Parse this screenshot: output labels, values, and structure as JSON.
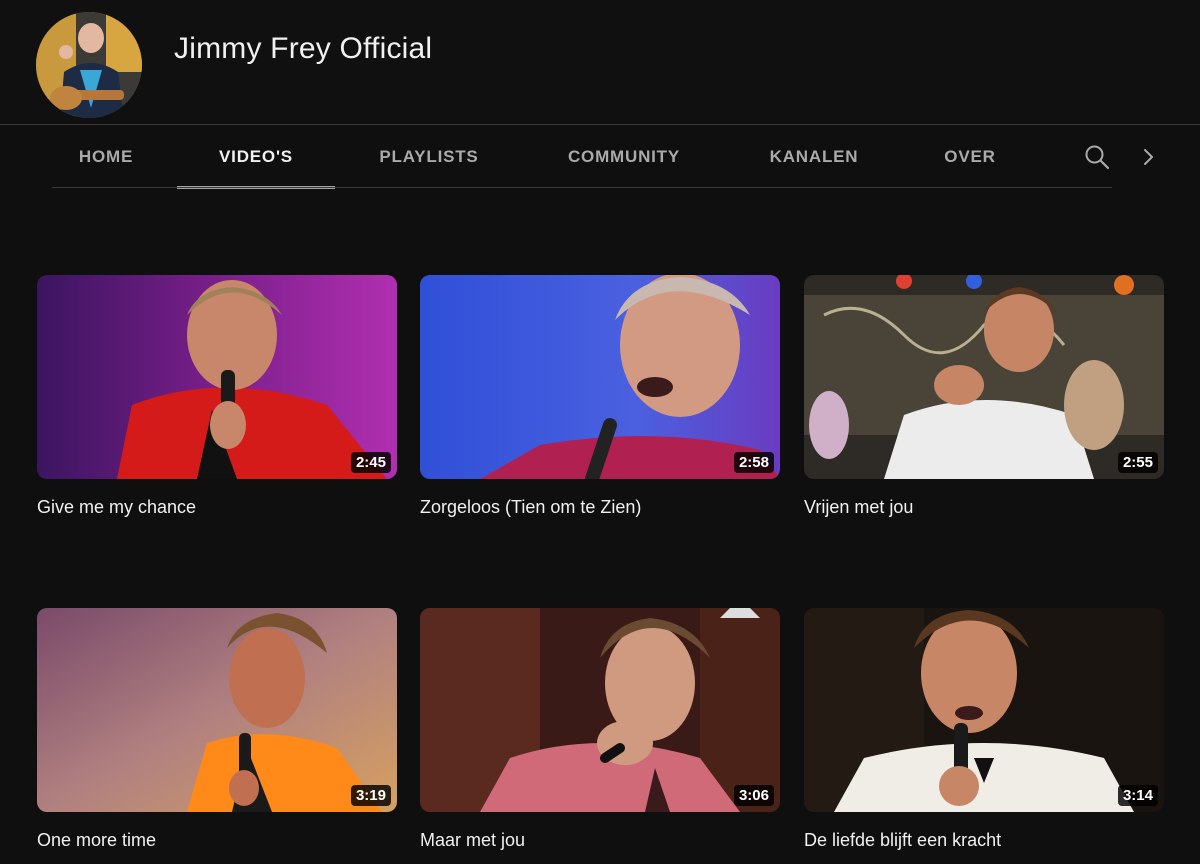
{
  "channel": {
    "name": "Jimmy Frey Official"
  },
  "tabs": [
    {
      "label": "HOME",
      "active": false
    },
    {
      "label": "VIDEO'S",
      "active": true
    },
    {
      "label": "PLAYLISTS",
      "active": false
    },
    {
      "label": "COMMUNITY",
      "active": false
    },
    {
      "label": "KANALEN",
      "active": false
    },
    {
      "label": "OVER",
      "active": false
    }
  ],
  "tab_icons": [
    "search-icon",
    "chevron-right-icon"
  ],
  "videos": [
    {
      "title": "Give me my chance",
      "duration": "2:45"
    },
    {
      "title": "Zorgeloos (Tien om te Zien)",
      "duration": "2:58"
    },
    {
      "title": "Vrijen met jou",
      "duration": "2:55"
    },
    {
      "title": "One more time",
      "duration": "3:19"
    },
    {
      "title": "Maar met jou",
      "duration": "3:06"
    },
    {
      "title": "De liefde blijft een kracht",
      "duration": "3:14"
    }
  ],
  "colors": {
    "background": "#0f0f0f",
    "text": "#f1f1f1",
    "tab_inactive": "#aaaaaa"
  }
}
